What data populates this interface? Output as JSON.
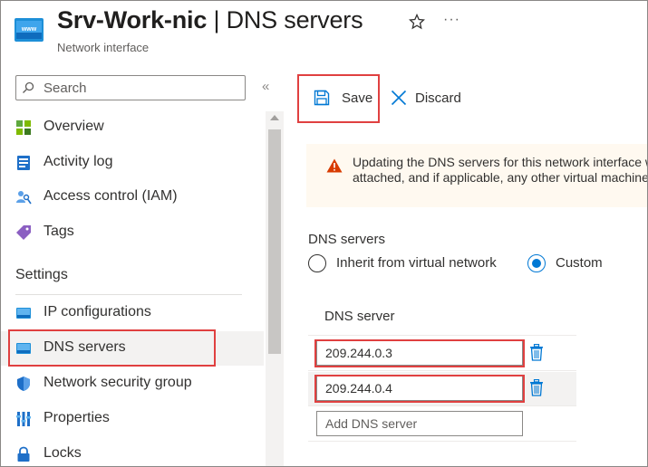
{
  "header": {
    "title_name": "Srv-Work-nic",
    "title_sep": " | ",
    "title_page": "DNS servers",
    "subtitle": "Network interface",
    "more_icon": "···"
  },
  "sidebar": {
    "search_placeholder": "Search",
    "collapse_icon": "«",
    "items": [
      {
        "label": "Overview",
        "icon": "overview-icon"
      },
      {
        "label": "Activity log",
        "icon": "activity-log-icon"
      },
      {
        "label": "Access control (IAM)",
        "icon": "iam-icon"
      },
      {
        "label": "Tags",
        "icon": "tag-icon"
      }
    ],
    "section": "Settings",
    "settings_items": [
      {
        "label": "IP configurations",
        "icon": "ip-config-icon"
      },
      {
        "label": "DNS servers",
        "icon": "dns-icon",
        "active": true
      },
      {
        "label": "Network security group",
        "icon": "shield-icon"
      },
      {
        "label": "Properties",
        "icon": "properties-icon"
      },
      {
        "label": "Locks",
        "icon": "lock-icon"
      }
    ]
  },
  "toolbar": {
    "save_label": "Save",
    "discard_label": "Discard"
  },
  "warning": {
    "line1": "Updating the DNS servers for this network interface will restart the virtual machine it is",
    "line2": "attached, and if applicable, any other virtual machines in the same availability set."
  },
  "dns": {
    "label": "DNS servers",
    "option_inherit": "Inherit from virtual network",
    "option_custom": "Custom",
    "selected": "Custom",
    "column_header": "DNS server",
    "servers": [
      "209.244.0.3",
      "209.244.0.4"
    ],
    "add_placeholder": "Add DNS server"
  },
  "colors": {
    "accent": "#0078d4",
    "highlight_box": "#e04040",
    "warning_icon": "#d83b01"
  }
}
